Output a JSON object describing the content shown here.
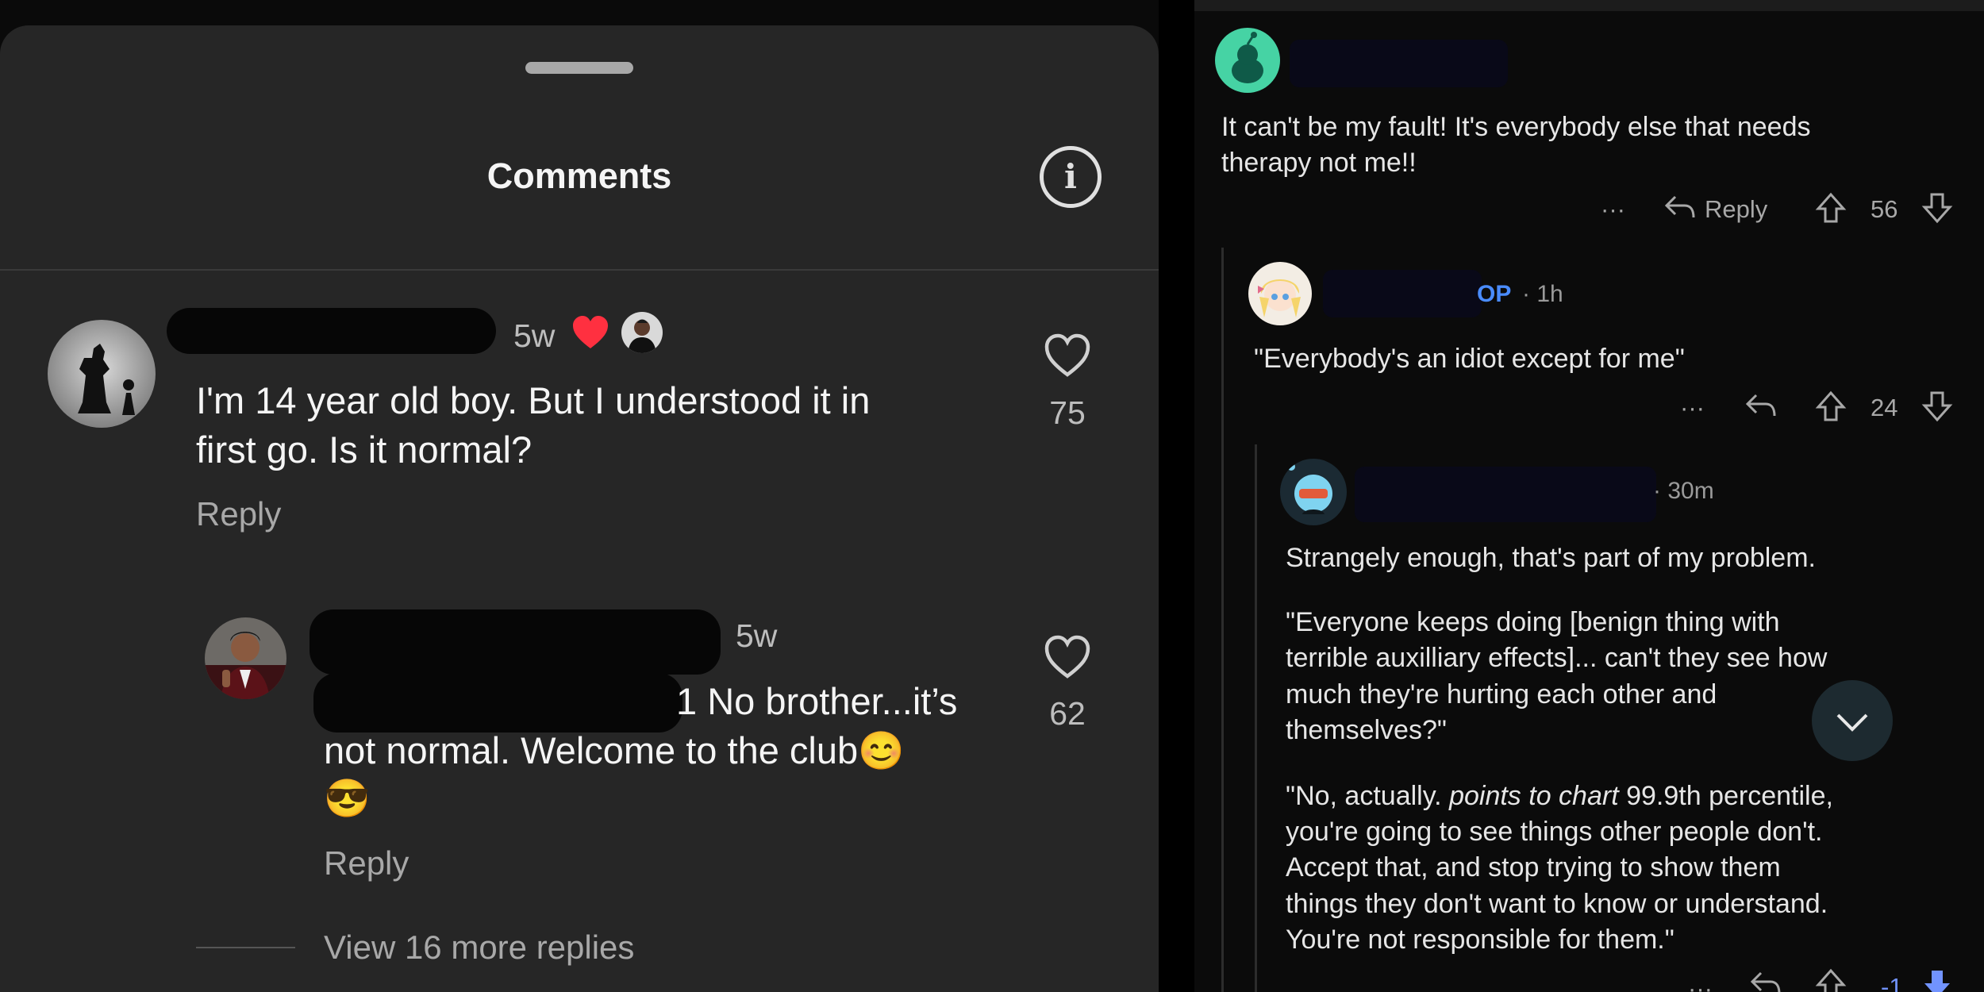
{
  "instagram": {
    "header": {
      "title": "Comments"
    },
    "comments": [
      {
        "time": "5w",
        "text_line1": "I'm 14 year old boy. But I understood it in",
        "text_line2": "first go. Is it normal?",
        "reply_label": "Reply",
        "likes": "75"
      },
      {
        "time": "5w",
        "text_line1": "1 No brother...it’s",
        "text_line2": "not normal. Welcome to the club😊",
        "text_line3": "😎",
        "reply_label": "Reply",
        "likes": "62"
      }
    ],
    "view_more": "View 16 more replies",
    "colors": {
      "sheet": "#262626",
      "heart_red": "#ff3040"
    }
  },
  "reddit": {
    "comments": [
      {
        "text_line1": "It can't be my fault! It's everybody else that needs",
        "text_line2": "therapy not me!!",
        "more": "···",
        "reply_label": "Reply",
        "score": "56"
      },
      {
        "op_badge": "OP",
        "time": "· 1h",
        "text": "\"Everybody's an idiot except for me\"",
        "more": "···",
        "score": "24"
      },
      {
        "time": "· 30m",
        "p1": "Strangely enough, that's part of my problem.",
        "p2_line1": "\"Everyone keeps doing [benign thing with",
        "p2_line2": "terrible auxilliary effects]... can't they see how",
        "p2_line3": "much they're hurting each other and",
        "p2_line4": "themselves?\"",
        "p3_prefix": "\"No, actually. ",
        "p3_italic": "points to chart",
        "p3_suffix": " 99.9th percentile,",
        "p3_line2": "you're going to see things other people don't.",
        "p3_line3": "Accept that, and stop trying to show them",
        "p3_line4": "things they don't want to know or understand.",
        "p3_line5": "You're not responsible for them.\"",
        "more": "···",
        "score": "-1"
      }
    ],
    "colors": {
      "op_blue": "#4a8cff",
      "downvote_blue": "#7193ff"
    }
  }
}
